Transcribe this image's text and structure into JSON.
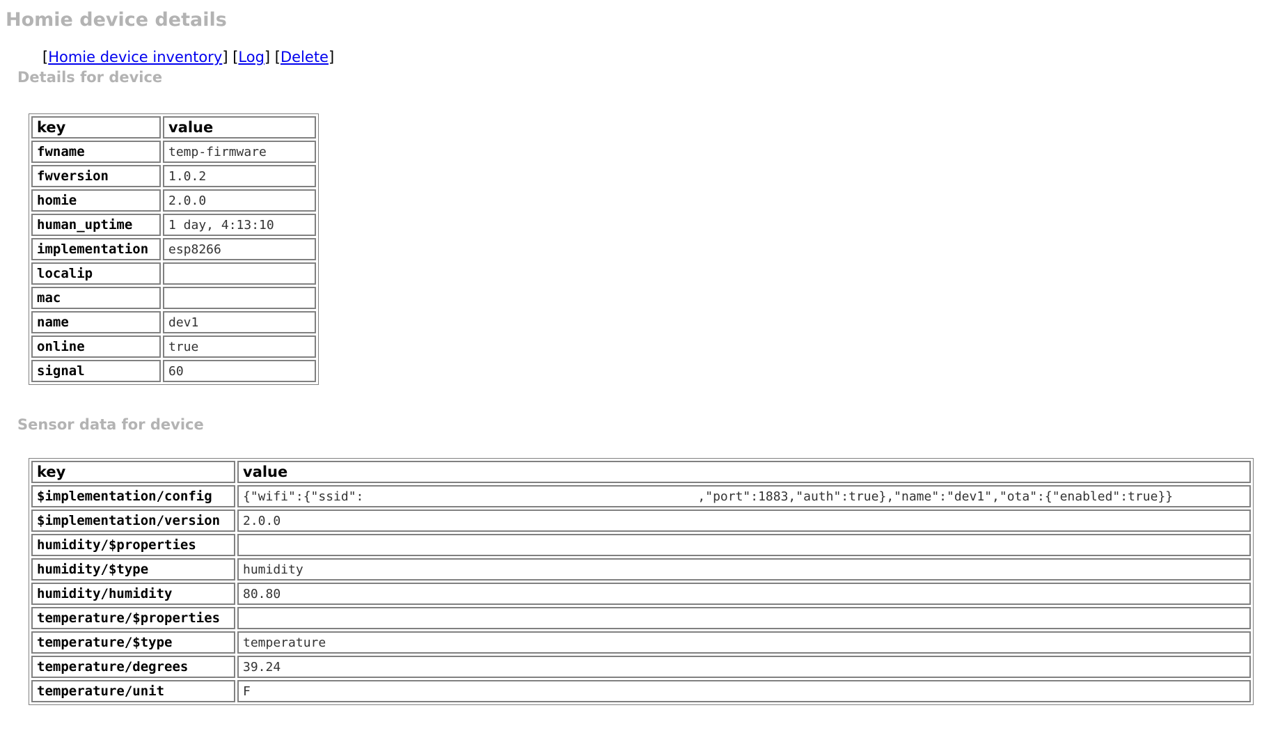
{
  "page": {
    "title": "Homie device details"
  },
  "nav": {
    "inventory_label": "Homie device inventory",
    "log_label": "Log",
    "delete_label": "Delete"
  },
  "details": {
    "heading": "Details for device",
    "col_key": "key",
    "col_value": "value",
    "rows": [
      {
        "key": "fwname",
        "value": "temp-firmware"
      },
      {
        "key": "fwversion",
        "value": "1.0.2"
      },
      {
        "key": "homie",
        "value": "2.0.0"
      },
      {
        "key": "human_uptime",
        "value": "1 day, 4:13:10"
      },
      {
        "key": "implementation",
        "value": "esp8266"
      },
      {
        "key": "localip",
        "value": ""
      },
      {
        "key": "mac",
        "value": ""
      },
      {
        "key": "name",
        "value": "dev1"
      },
      {
        "key": "online",
        "value": "true"
      },
      {
        "key": "signal",
        "value": "60"
      }
    ]
  },
  "sensor": {
    "heading": "Sensor data for device",
    "col_key": "key",
    "col_value": "value",
    "config_prefix": "{\"wifi\":{\"ssid\":",
    "config_suffix": ",\"port\":1883,\"auth\":true},\"name\":\"dev1\",\"ota\":{\"enabled\":true}}",
    "rows": [
      {
        "key": "$implementation/config",
        "value": ""
      },
      {
        "key": "$implementation/version",
        "value": "2.0.0"
      },
      {
        "key": "humidity/$properties",
        "value": ""
      },
      {
        "key": "humidity/$type",
        "value": "humidity"
      },
      {
        "key": "humidity/humidity",
        "value": "80.80"
      },
      {
        "key": "temperature/$properties",
        "value": ""
      },
      {
        "key": "temperature/$type",
        "value": "temperature"
      },
      {
        "key": "temperature/degrees",
        "value": "39.24"
      },
      {
        "key": "temperature/unit",
        "value": "F"
      }
    ]
  }
}
